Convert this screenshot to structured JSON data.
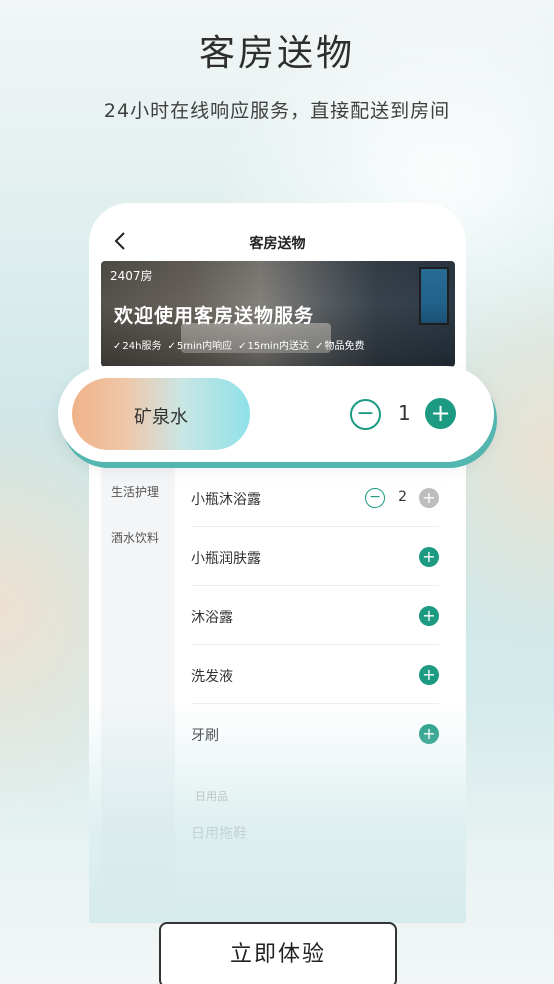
{
  "hero": {
    "title": "客房送物",
    "subtitle": "24小时在线响应服务，直接配送到房间"
  },
  "phone": {
    "header_title": "客房送物",
    "banner": {
      "room_number": "2407房",
      "title": "欢迎使用客房送物服务",
      "features": [
        "24h服务",
        "5min内响应",
        "15min内送达",
        "物品免费"
      ]
    },
    "categories": [
      "生活护理",
      "酒水饮料"
    ],
    "items": [
      {
        "name": "小瓶沐浴露",
        "quantity": "2"
      },
      {
        "name": "小瓶润肤露"
      },
      {
        "name": "沐浴露"
      },
      {
        "name": "洗发液"
      },
      {
        "name": "牙刷"
      }
    ],
    "section_label": "日用品",
    "faded_item": "日用拖鞋"
  },
  "popup": {
    "item_name": "矿泉水",
    "quantity": "1"
  },
  "cta": {
    "label": "立即体验"
  },
  "colors": {
    "accent": "#1c9b82",
    "popup_shadow": "#54b6b0"
  },
  "icons": [
    "back-chevron-icon",
    "check-icon",
    "minus-circle-icon",
    "plus-circle-icon"
  ]
}
